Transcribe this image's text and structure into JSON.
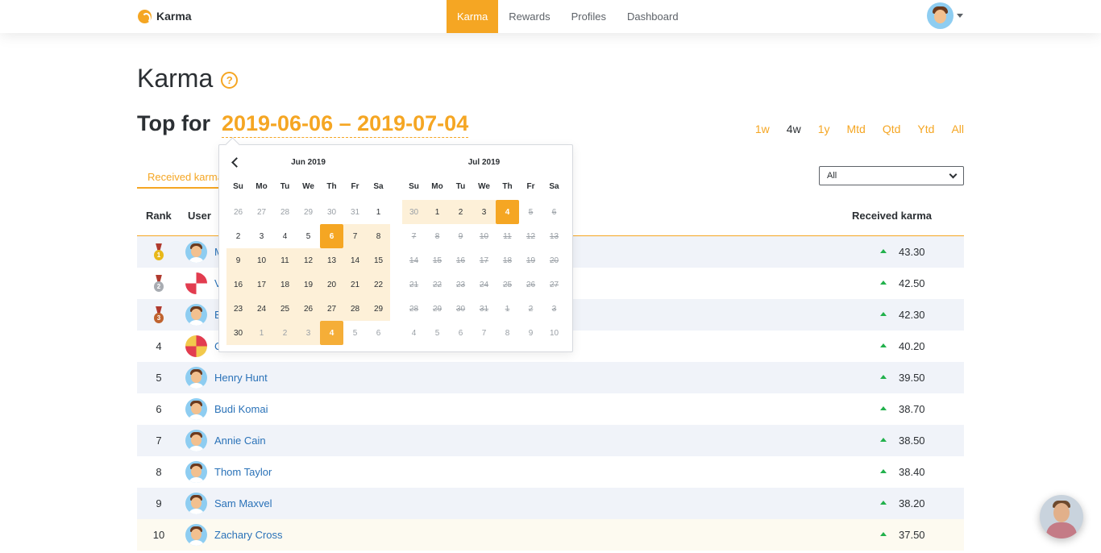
{
  "nav": {
    "brand": "Karma",
    "items": [
      {
        "label": "Karma",
        "active": true
      },
      {
        "label": "Rewards",
        "active": false
      },
      {
        "label": "Profiles",
        "active": false
      },
      {
        "label": "Dashboard",
        "active": false
      }
    ]
  },
  "page": {
    "title": "Karma",
    "help_icon": "?",
    "top_for_label": "Top for",
    "top_for_range": "2019-06-06 – 2019-07-04"
  },
  "periods": [
    {
      "label": "1w",
      "active": false
    },
    {
      "label": "4w",
      "active": true
    },
    {
      "label": "1y",
      "active": false
    },
    {
      "label": "Mtd",
      "active": false
    },
    {
      "label": "Qtd",
      "active": false
    },
    {
      "label": "Ytd",
      "active": false
    },
    {
      "label": "All",
      "active": false
    }
  ],
  "tab": {
    "label": "Received karma"
  },
  "filter": {
    "selected": "All"
  },
  "table": {
    "headers": {
      "rank": "Rank",
      "user": "User",
      "karma": "Received karma"
    },
    "rows": [
      {
        "rank": "",
        "medal": "gold",
        "name": "M",
        "score": "43.30",
        "avatar": "light-blue"
      },
      {
        "rank": "",
        "medal": "silver",
        "name": "V",
        "score": "42.50",
        "avatar": "red-white"
      },
      {
        "rank": "",
        "medal": "bronze",
        "name": "E",
        "score": "42.30",
        "avatar": "light-blue"
      },
      {
        "rank": "4",
        "medal": "",
        "name": "C",
        "score": "40.20",
        "avatar": "red-yellow"
      },
      {
        "rank": "5",
        "medal": "",
        "name": "Henry Hunt",
        "score": "39.50",
        "avatar": "light-blue"
      },
      {
        "rank": "6",
        "medal": "",
        "name": "Budi Komai",
        "score": "38.70",
        "avatar": "light-blue"
      },
      {
        "rank": "7",
        "medal": "",
        "name": "Annie Cain",
        "score": "38.50",
        "avatar": "light-blue"
      },
      {
        "rank": "8",
        "medal": "",
        "name": "Thom Taylor",
        "score": "38.40",
        "avatar": "light-blue"
      },
      {
        "rank": "9",
        "medal": "",
        "name": "Sam Maxvel",
        "score": "38.20",
        "avatar": "light-blue"
      },
      {
        "rank": "10",
        "medal": "",
        "name": "Zachary Cross",
        "score": "37.50",
        "avatar": "light-blue"
      }
    ]
  },
  "datepicker": {
    "weekdays": [
      "Su",
      "Mo",
      "Tu",
      "We",
      "Th",
      "Fr",
      "Sa"
    ],
    "months": [
      {
        "title": "Jun 2019",
        "days": [
          {
            "d": "26",
            "s": "other"
          },
          {
            "d": "27",
            "s": "other"
          },
          {
            "d": "28",
            "s": "other"
          },
          {
            "d": "29",
            "s": "other"
          },
          {
            "d": "30",
            "s": "other"
          },
          {
            "d": "31",
            "s": "other"
          },
          {
            "d": "1",
            "s": ""
          },
          {
            "d": "2",
            "s": ""
          },
          {
            "d": "3",
            "s": ""
          },
          {
            "d": "4",
            "s": ""
          },
          {
            "d": "5",
            "s": ""
          },
          {
            "d": "6",
            "s": "sel"
          },
          {
            "d": "7",
            "s": "range"
          },
          {
            "d": "8",
            "s": "range"
          },
          {
            "d": "9",
            "s": "range"
          },
          {
            "d": "10",
            "s": "range"
          },
          {
            "d": "11",
            "s": "range"
          },
          {
            "d": "12",
            "s": "range"
          },
          {
            "d": "13",
            "s": "range"
          },
          {
            "d": "14",
            "s": "range"
          },
          {
            "d": "15",
            "s": "range"
          },
          {
            "d": "16",
            "s": "range"
          },
          {
            "d": "17",
            "s": "range"
          },
          {
            "d": "18",
            "s": "range"
          },
          {
            "d": "19",
            "s": "range"
          },
          {
            "d": "20",
            "s": "range"
          },
          {
            "d": "21",
            "s": "range"
          },
          {
            "d": "22",
            "s": "range"
          },
          {
            "d": "23",
            "s": "range"
          },
          {
            "d": "24",
            "s": "range"
          },
          {
            "d": "25",
            "s": "range"
          },
          {
            "d": "26",
            "s": "range"
          },
          {
            "d": "27",
            "s": "range"
          },
          {
            "d": "28",
            "s": "range"
          },
          {
            "d": "29",
            "s": "range"
          },
          {
            "d": "30",
            "s": "range"
          },
          {
            "d": "1",
            "s": "other range"
          },
          {
            "d": "2",
            "s": "other range"
          },
          {
            "d": "3",
            "s": "other range"
          },
          {
            "d": "4",
            "s": "other sel"
          },
          {
            "d": "5",
            "s": "other"
          },
          {
            "d": "6",
            "s": "other"
          }
        ]
      },
      {
        "title": "Jul 2019",
        "days": [
          {
            "d": "30",
            "s": "other range"
          },
          {
            "d": "1",
            "s": "range"
          },
          {
            "d": "2",
            "s": "range"
          },
          {
            "d": "3",
            "s": "range"
          },
          {
            "d": "4",
            "s": "sel"
          },
          {
            "d": "5",
            "s": "dis"
          },
          {
            "d": "6",
            "s": "dis"
          },
          {
            "d": "7",
            "s": "dis"
          },
          {
            "d": "8",
            "s": "dis"
          },
          {
            "d": "9",
            "s": "dis"
          },
          {
            "d": "10",
            "s": "dis"
          },
          {
            "d": "11",
            "s": "dis"
          },
          {
            "d": "12",
            "s": "dis"
          },
          {
            "d": "13",
            "s": "dis"
          },
          {
            "d": "14",
            "s": "dis"
          },
          {
            "d": "15",
            "s": "dis"
          },
          {
            "d": "16",
            "s": "dis"
          },
          {
            "d": "17",
            "s": "dis"
          },
          {
            "d": "18",
            "s": "dis"
          },
          {
            "d": "19",
            "s": "dis"
          },
          {
            "d": "20",
            "s": "dis"
          },
          {
            "d": "21",
            "s": "dis"
          },
          {
            "d": "22",
            "s": "dis"
          },
          {
            "d": "23",
            "s": "dis"
          },
          {
            "d": "24",
            "s": "dis"
          },
          {
            "d": "25",
            "s": "dis"
          },
          {
            "d": "26",
            "s": "dis"
          },
          {
            "d": "27",
            "s": "dis"
          },
          {
            "d": "28",
            "s": "dis"
          },
          {
            "d": "29",
            "s": "dis"
          },
          {
            "d": "30",
            "s": "dis"
          },
          {
            "d": "31",
            "s": "dis"
          },
          {
            "d": "1",
            "s": "dis"
          },
          {
            "d": "2",
            "s": "dis"
          },
          {
            "d": "3",
            "s": "dis"
          },
          {
            "d": "4",
            "s": "other"
          },
          {
            "d": "5",
            "s": "other"
          },
          {
            "d": "6",
            "s": "other"
          },
          {
            "d": "7",
            "s": "other"
          },
          {
            "d": "8",
            "s": "other"
          },
          {
            "d": "9",
            "s": "other"
          },
          {
            "d": "10",
            "s": "other"
          }
        ]
      }
    ]
  },
  "colors": {
    "accent": "#f5a623",
    "link": "#2a72b8",
    "trend_up": "#22b14c",
    "row_shade": "#f0f3f9",
    "range_fill": "#fdf0d8"
  },
  "icons": {
    "brand": "karma-logo-icon",
    "help": "question-circle-icon",
    "prev": "chevron-left-icon",
    "dropdown": "chevron-down-icon",
    "trend": "triangle-up-icon",
    "chat": "chat-avatar-icon"
  }
}
